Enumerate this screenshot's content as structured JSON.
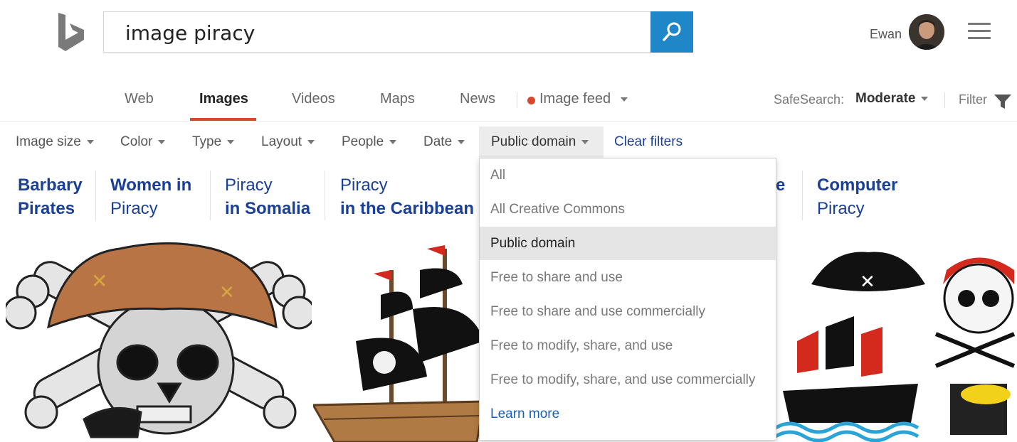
{
  "header": {
    "logo": "bing-logo",
    "search_query": "image piracy",
    "search_button_icon": "search-icon",
    "user_name": "Ewan",
    "menu_icon": "hamburger-menu-icon"
  },
  "nav": {
    "tabs": [
      {
        "label": "Web"
      },
      {
        "label": "Images"
      },
      {
        "label": "Videos"
      },
      {
        "label": "Maps"
      },
      {
        "label": "News"
      },
      {
        "label": "Image feed"
      }
    ],
    "active_tab": "Images",
    "safesearch_label": "SafeSearch:",
    "safesearch_value": "Moderate",
    "filter_label": "Filter"
  },
  "filters": {
    "items": [
      {
        "label": "Image size"
      },
      {
        "label": "Color"
      },
      {
        "label": "Type"
      },
      {
        "label": "Layout"
      },
      {
        "label": "People"
      },
      {
        "label": "Date"
      },
      {
        "label": "Public domain"
      }
    ],
    "clear_label": "Clear filters"
  },
  "related_searches": [
    {
      "line1": "Barbary",
      "line2": "Pirates"
    },
    {
      "line1": "Women in",
      "line2": "Piracy"
    },
    {
      "line1": "Piracy",
      "line2": "in Somalia"
    },
    {
      "line1": "Piracy",
      "line2": "in the Caribbean"
    },
    {
      "line1": "",
      "line2": "e"
    },
    {
      "line1": "Computer",
      "line2": "Piracy"
    }
  ],
  "license_dropdown": {
    "options": [
      {
        "label": "All"
      },
      {
        "label": "All Creative Commons"
      },
      {
        "label": "Public domain"
      },
      {
        "label": "Free to share and use"
      },
      {
        "label": "Free to share and use commercially"
      },
      {
        "label": "Free to modify, share, and use"
      },
      {
        "label": "Free to modify, share, and use commercially"
      }
    ],
    "selected": "Public domain",
    "learn_more": "Learn more"
  },
  "colors": {
    "accent": "#d9482b",
    "search_button": "#1f87c7",
    "link": "#1a3f98"
  }
}
